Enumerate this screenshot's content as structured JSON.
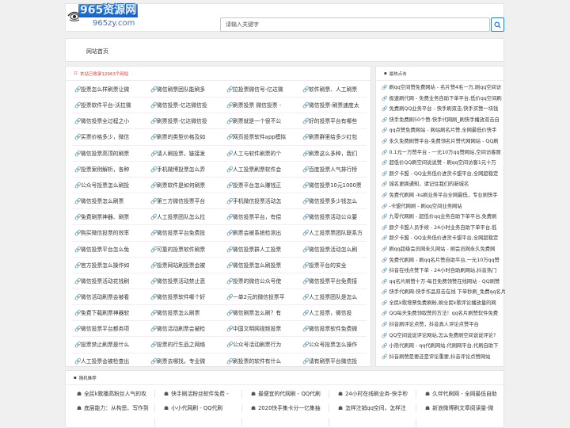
{
  "logo": {
    "main": "965资源网",
    "sub": "965zy.com"
  },
  "search": {
    "placeholder": "请输入关键字"
  },
  "nav": {
    "home": "网站首页"
  },
  "main": {
    "title": "本站已收录12963个网站",
    "cells": [
      "投票怎么样刷票让微",
      "微信刷票团队能刷多",
      "拉投票微信号-亿达微",
      "软件刷票、人工刷票",
      "投票软件平台-沃拉微",
      "微信投票-亿达微信投",
      "刷票投票 微信投票 -",
      "微信投票-刷票速度太",
      "微信投票全过程之小",
      "刷票投票-亿达微信投",
      "刷票就是一个很不公",
      "好的投票平台有哪些",
      "买票价格多少，微信",
      "刷票的类型价格及如",
      "网页投票软件app模拟",
      "刷票群里给多少红包",
      "微信投票高顶的刷票",
      "请人刷投票，链接发",
      "人工与软件刷票的个",
      "刷票这么多种，我们",
      "投票案例解析，各种",
      "手机微博投票怎么弄",
      "人工投票刷票软件会",
      "百度投票人气排行榜",
      "公众号投票怎么刷投",
      "刷票软件是如何刷票",
      "投票平台怎么赚钱正",
      "微信投票10元1000票",
      "微信投票怎么刷票",
      "第三方微信投票平台",
      "手机微信投票活动怎",
      "微信投票多少钱怎么",
      "免费刷票神器、刷票",
      "人工投票团队怎么拉",
      "微信投票平台，有偿",
      "微信投票活动公众要",
      "购买微信投票的效率",
      "微信投票平台免费投",
      "刷票会被系统检测出",
      "人工投票票团队联系方",
      "微信投票平台怎么免",
      "可靠的投票软件刷票",
      "微信投票群人工投票",
      "微信投票活动怎么刷",
      "官方投票怎么操作如",
      "投票网站刷投票会被",
      "微信投票怎么刷投票",
      "投票平台的安全",
      "微信投票活动花钱刷",
      "微信投票活动禁止恶",
      "投票的微信公众号使",
      "微信投票平台免费接",
      "微信活动刷票会被看",
      "微信投票软件哪个好",
      "一单2元的微信投票平",
      "人工投票团队是怎么",
      "免费下载刷票神器软",
      "微信投票怎么刷票",
      "微信刷票怎么刷？有",
      "人工投票，微信投",
      "微信投票平台都务项",
      "微信活动刷票会被检",
      "中国文明网视频投票",
      "微信投票软件免费微",
      "投票禁止刷票是什么",
      "投票的行生品之网络",
      "公众号活动刷票行为",
      "公众号投票怎么操作",
      "人工投票会被检查出",
      "刷票去哪找，专业微",
      "刷投票的软件有什么",
      "请有刷票平台微信投"
    ]
  },
  "side": {
    "title": "最热点击",
    "items": [
      "刷qq空间赞免费网站 - 名片赞4毛一万,刷qq空间访",
      "极速刷代网 - 免费业务自助下单平台,低价qq空间刷",
      "免费刷QQ业务平台 - 快手刷双击,快手买赞一块钱",
      "快手免费刷50个赞-快手代网刷_刷快手播放双击自",
      "qq点赞免费网站 - 网站刷名片赞,全网最低价快手",
      "永久免费刷赞平台-免费领名片赞代网网站 - QQ刷",
      "0.1元一万赞平台 - 一元10万qq赞网站,空间访客原",
      "超低价QQ刷空间说说赞 - 刷qq空间访客1元十万",
      "颜夕卡盟 - QQ业务低价进货卡盟平台,全网超稳定",
      "城名更换通知，请记住我们的新城名",
      "免费代刷网 -ks刷业务平台全网最低，专业刷快手",
      "-卡盟代网刷 - 刷qq空间业务网站",
      "九零代网刷 - 超低价qq业务自助下单平台,免费刷",
      "颜夕卡盟人员手续 - 24小时业务自助下单平台,低",
      "颜夕卡盟 - QQ业务低价进货卡盟平台,全网超稳定",
      "刷qq超级会员网永久网站 - 刷会员网永久免费网",
      "免费代刷网 - 刷qq名片赞自助平台,一元10万qq赞",
      "抖音在线点赞下单 - 24小时自助刷网站,抖音热门",
      "qq名片刷赞十万-每日免费领赞在线网站 - QQ刷赞",
      "快手代刷网-快手作品双击在线 下单秒刷_免费qq名片",
      "全民k歌增票免费刷粉,刷全民k歌评论播放量的网",
      "QQ每天免费领取赞的方法！qq名片刷赞软件免费",
      "抖音刷评论点赞，抖音真人评论点赞平台",
      "QQ空间说说评论网站,怎么免费刷空间说说评论?",
      "小熊代刷网 - qq代刷网站,代刷网平台,代刷自助下",
      "抖音刷赞是要还是评论重要,抖音评论点赞网站"
    ]
  },
  "rec": {
    "title": "随机推荐",
    "items": [
      "全民k歌播高粉丝人气的攻",
      "快手刷活粉丝软件免费 -",
      "最便宜的代网刷 - QQ代刷",
      "24小时在线刷业务-快手秒",
      "久伴代刷网 - 全网最低自助",
      "底层能力：从构思、写作到",
      "小小代网刷 - QQ代刷",
      "2020快手集卡分一亿集抽",
      "怎样注销qq空间，怎样注",
      "新浪微博刷文章阅读量-微",
      "",
      "",
      "",
      "",
      ""
    ]
  },
  "colors": {
    "accent": "#2a7de1",
    "alert": "#e23b2f"
  }
}
